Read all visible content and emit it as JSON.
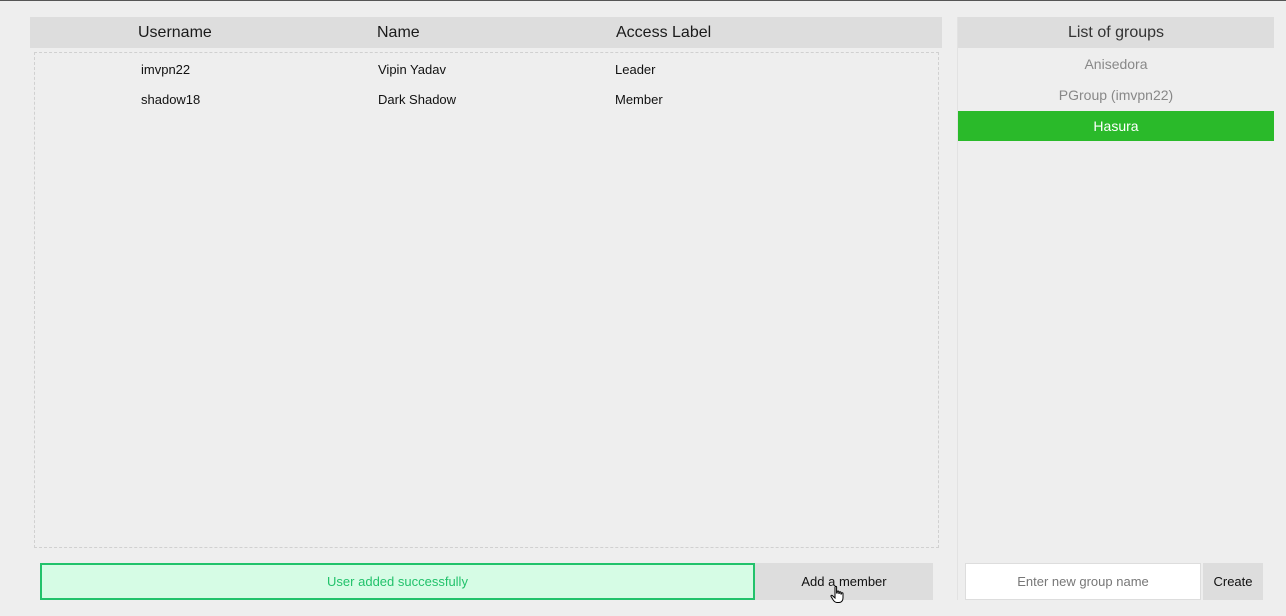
{
  "members_table": {
    "columns": [
      "Username",
      "Name",
      "Access Label"
    ],
    "rows": [
      {
        "username": "imvpn22",
        "name": "Vipin Yadav",
        "access": "Leader"
      },
      {
        "username": "shadow18",
        "name": "Dark Shadow",
        "access": "Member"
      }
    ]
  },
  "status": {
    "message": "User added successfully",
    "color": "#22c26b"
  },
  "actions": {
    "add_member_label": "Add a member"
  },
  "groups": {
    "title": "List of groups",
    "items": [
      {
        "label": "Anisedora",
        "selected": false
      },
      {
        "label": "PGroup (imvpn22)",
        "selected": false
      },
      {
        "label": "Hasura",
        "selected": true
      }
    ],
    "selected_color": "#2aba2a",
    "new_group_placeholder": "Enter new group name",
    "new_group_value": "",
    "create_label": "Create"
  },
  "icons": {
    "cursor": "hand-pointer-cursor-icon"
  }
}
